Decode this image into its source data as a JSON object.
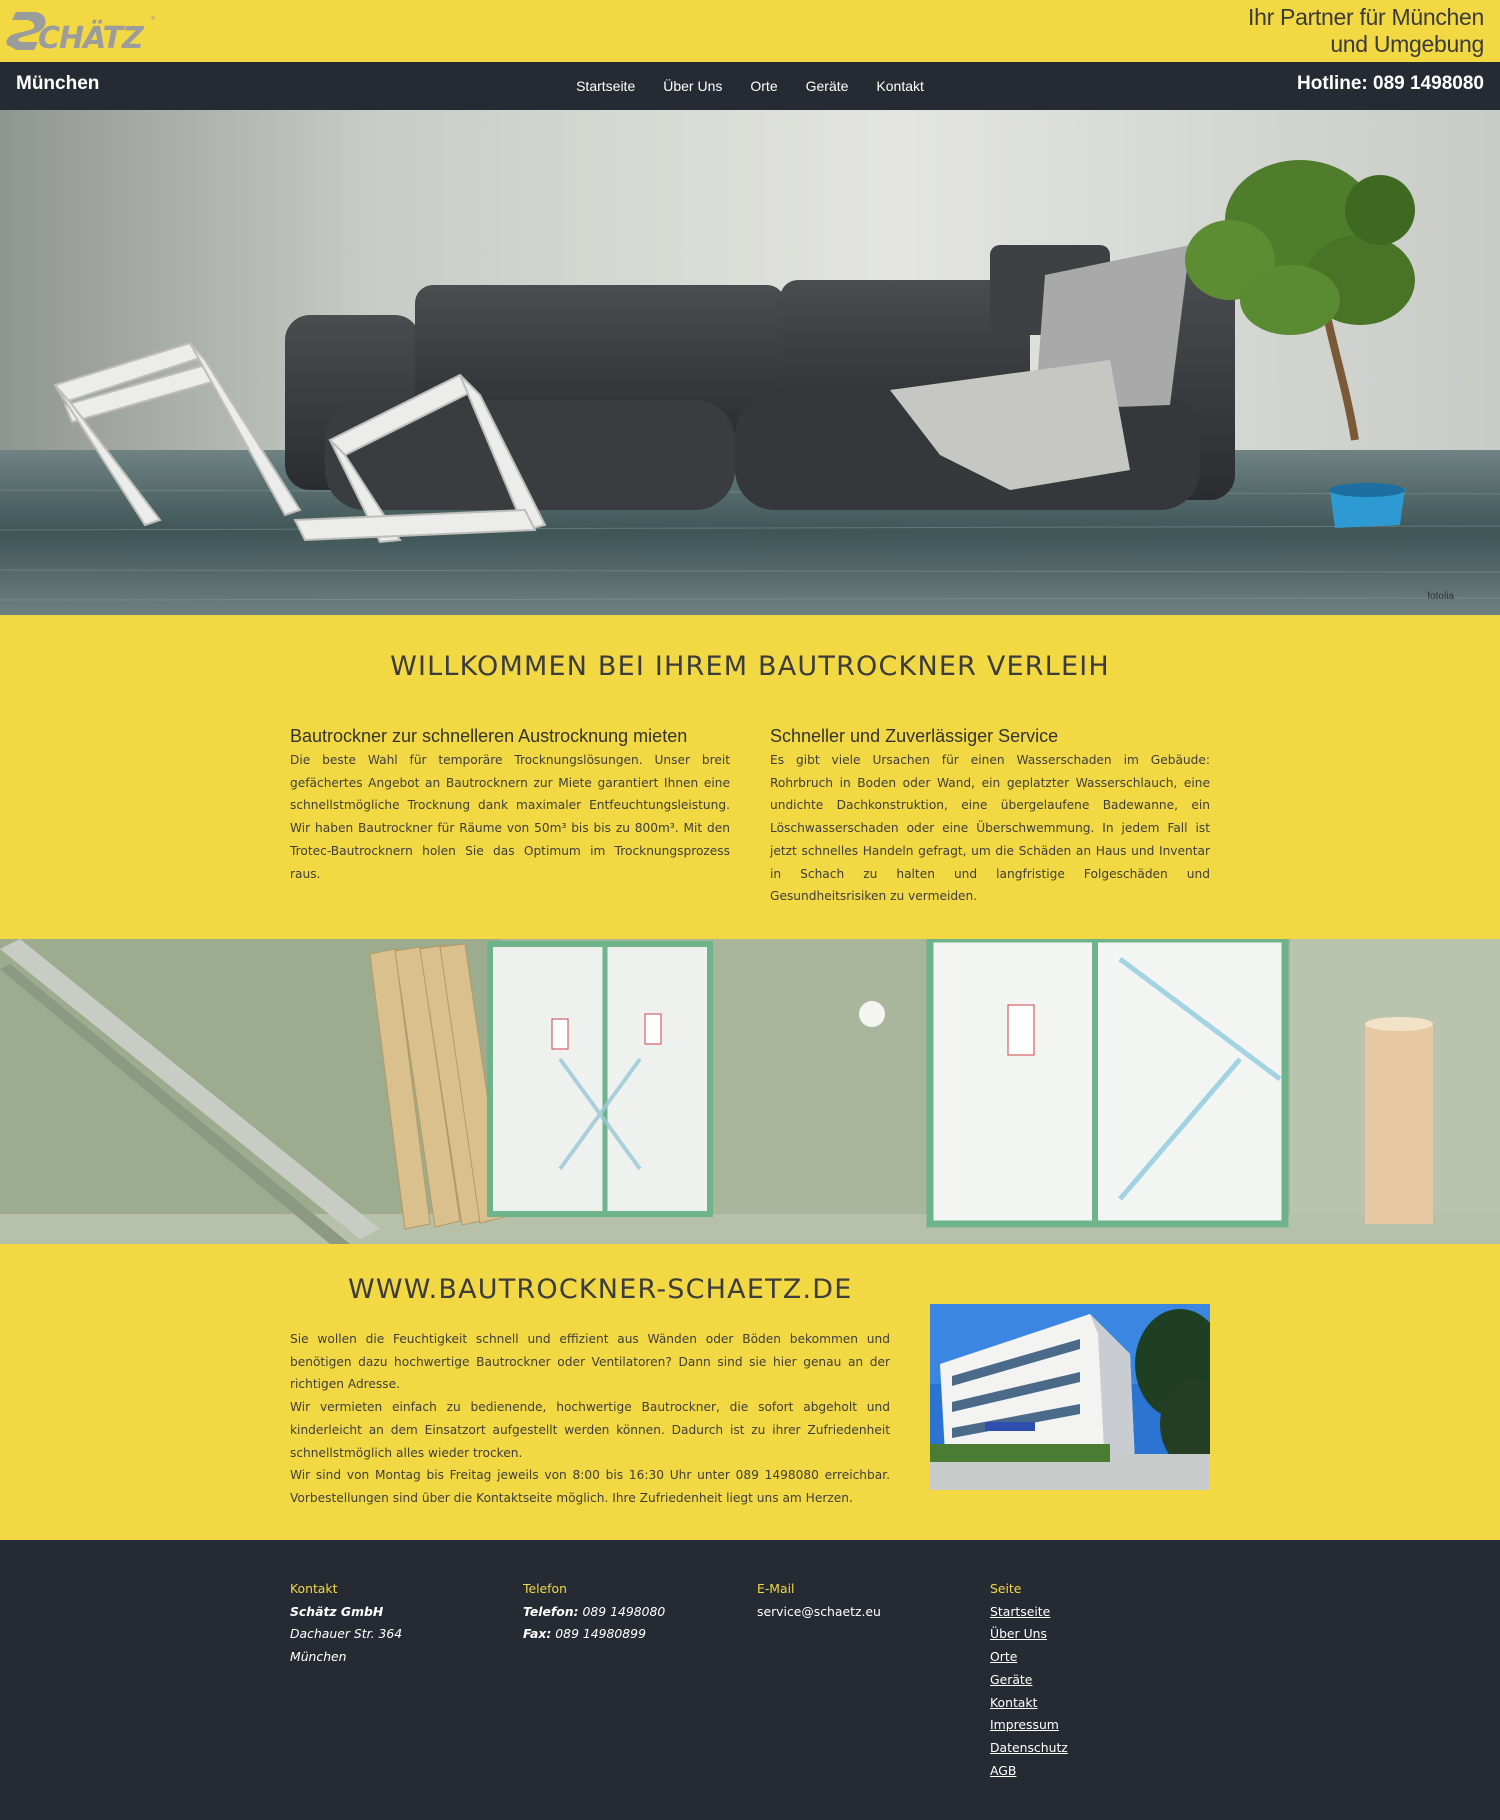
{
  "header": {
    "logo_text": "SCHÄTZ",
    "tagline_line1": "Ihr Partner für München",
    "tagline_line2": "und Umgebung"
  },
  "nav": {
    "city": "München",
    "items": [
      {
        "label": "Startseite"
      },
      {
        "label": "Über Uns"
      },
      {
        "label": "Orte"
      },
      {
        "label": "Geräte"
      },
      {
        "label": "Kontakt"
      }
    ],
    "hotline": "Hotline: 089 1498080"
  },
  "hero": {
    "credit": "fotolia"
  },
  "welcome": {
    "title": "WILLKOMMEN BEI IHREM BAUTROCKNER VERLEIH",
    "left": {
      "heading": "Bautrockner zur schnelleren Austrocknung mieten",
      "text": "Die beste Wahl für temporäre Trocknungslösungen. Unser breit gefächertes Angebot an Bautrocknern zur Miete garantiert Ihnen eine schnellstmögliche Trocknung dank maximaler Entfeuchtungsleistung. Wir haben Bautrockner für Räume von 50m³ bis bis zu 800m³. Mit den Trotec-Bautrocknern holen Sie das Optimum im Trocknungsprozess raus."
    },
    "right": {
      "heading": "Schneller und Zuverlässiger Service",
      "text": "Es gibt viele Ursachen für einen Wasserschaden im Gebäude: Rohrbruch in Boden oder Wand, ein geplatzter Wasserschlauch, eine undichte Dachkonstruktion, eine übergelaufene Badewanne, ein Löschwasserschaden oder eine Überschwemmung. In jedem Fall ist jetzt schnelles Handeln gefragt, um die Schäden an Haus und Inventar in Schach zu halten und langfristige Folgeschäden und Gesundheitsrisiken zu vermeiden."
    }
  },
  "info": {
    "title": "WWW.BAUTROCKNER-SCHAETZ.DE",
    "p1": "Sie wollen die Feuchtigkeit schnell und effizient aus Wänden oder Böden bekommen und benötigen dazu hochwertige Bautrockner oder Ventilatoren? Dann sind sie hier genau an der richtigen Adresse.",
    "p2": "Wir vermieten einfach zu bedienende, hochwertige Bautrockner, die sofort abgeholt und kinderleicht an dem Einsatzort aufgestellt werden können. Dadurch ist zu ihrer Zufriedenheit schnellstmöglich alles wieder trocken.",
    "p3": "Wir sind von Montag bis Freitag jeweils von 8:00 bis 16:30 Uhr unter 089 1498080 erreichbar. Vorbestellungen sind über die Kontaktseite möglich. Ihre Zufriedenheit liegt uns am Herzen."
  },
  "footer": {
    "kontakt": {
      "heading": "Kontakt",
      "company": "Schätz GmbH",
      "street": "Dachauer Str. 364",
      "city": "München"
    },
    "telefon": {
      "heading": "Telefon",
      "tel_label": "Telefon:",
      "tel_value": " 089 1498080",
      "fax_label": "Fax:",
      "fax_value": " 089 14980899"
    },
    "email": {
      "heading": "E-Mail",
      "address": "service@schaetz.eu"
    },
    "seite": {
      "heading": "Seite",
      "links": [
        {
          "label": "Startseite"
        },
        {
          "label": "Über Uns"
        },
        {
          "label": "Orte"
        },
        {
          "label": "Geräte"
        },
        {
          "label": "Kontakt"
        },
        {
          "label": "Impressum"
        },
        {
          "label": "Datenschutz"
        },
        {
          "label": "AGB"
        }
      ]
    }
  },
  "colors": {
    "accent": "#f2d843",
    "dark": "#262b33"
  }
}
